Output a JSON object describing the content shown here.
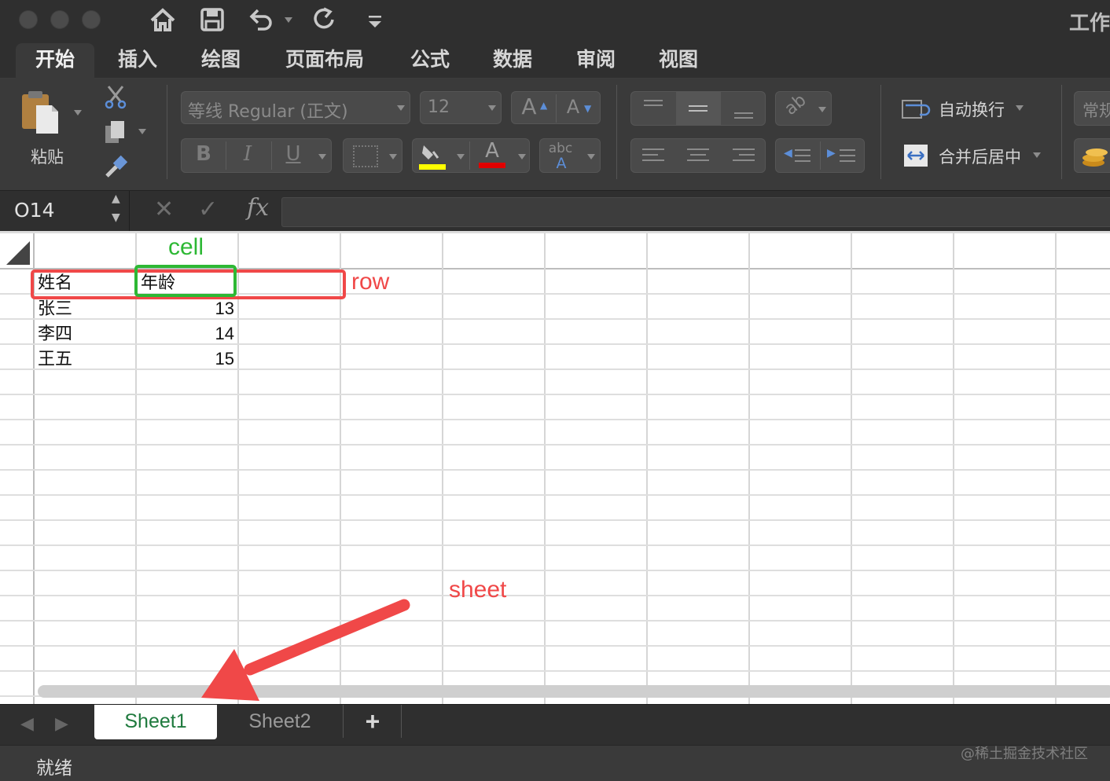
{
  "window": {
    "title": "工作"
  },
  "quick_access": {
    "icons": [
      "home-icon",
      "save-icon",
      "undo-icon",
      "redo-icon",
      "customize-icon"
    ]
  },
  "ribbon_tabs": [
    "开始",
    "插入",
    "绘图",
    "页面布局",
    "公式",
    "数据",
    "审阅",
    "视图"
  ],
  "active_tab": "开始",
  "ribbon": {
    "paste_label": "粘贴",
    "font_name": "等线 Regular (正文)",
    "font_size": "12",
    "bold": "B",
    "italic": "I",
    "underline": "U",
    "grow_font": "A",
    "shrink_font": "A",
    "font_color_glyph": "A",
    "phonetic_glyph_top": "abc",
    "phonetic_glyph_bottom": "A",
    "wrap_text": "自动换行",
    "merge_center": "合并后居中",
    "number_format": "常规",
    "fill_color": "#ffff00",
    "font_color": "#e00000"
  },
  "formula_bar": {
    "cell_ref": "O14",
    "fx": "fx",
    "value": ""
  },
  "sheet": {
    "rows": [
      [
        "姓名",
        "年龄"
      ],
      [
        "张三",
        "13"
      ],
      [
        "李四",
        "14"
      ],
      [
        "王五",
        "15"
      ]
    ]
  },
  "annotations": {
    "cell": "cell",
    "row": "row",
    "sheet": "sheet"
  },
  "annotation_colors": {
    "cell": "#2db834",
    "row": "#f04848",
    "sheet": "#f04848"
  },
  "sheet_tabs": [
    "Sheet1",
    "Sheet2"
  ],
  "active_sheet": "Sheet1",
  "add_sheet": "+",
  "status": {
    "text": "就绪",
    "watermark": "@稀土掘金技术社区"
  }
}
